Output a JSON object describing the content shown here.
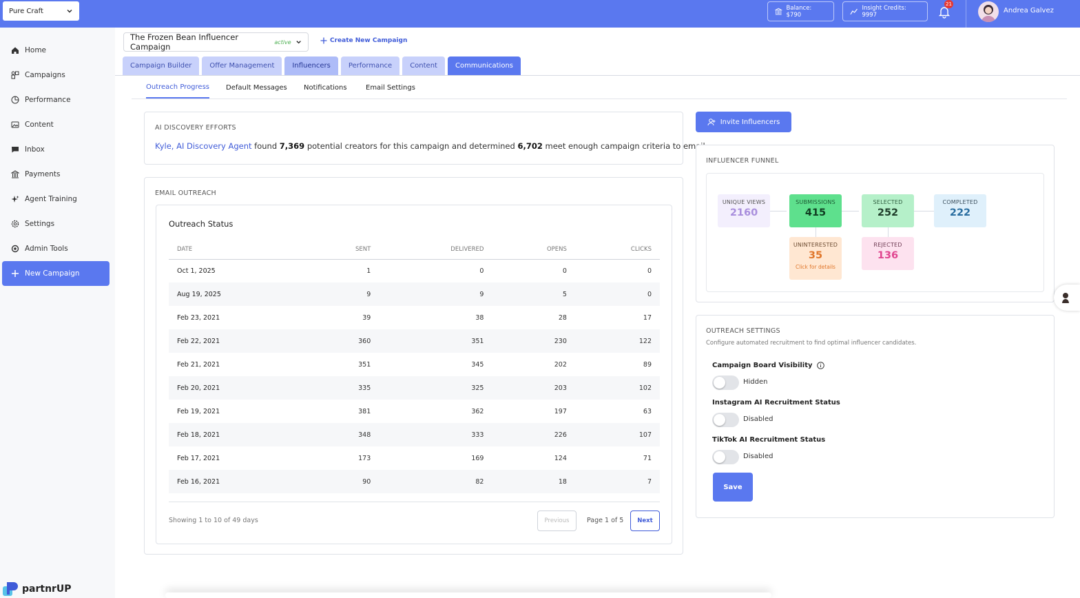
{
  "topbar": {
    "org": "Pure Craft",
    "balance": "Balance: $790",
    "credits": "Insight Credits: 9997",
    "notif_count": "21",
    "user_name": "Andrea Galvez"
  },
  "sidebar": {
    "items": [
      {
        "label": "Home"
      },
      {
        "label": "Campaigns"
      },
      {
        "label": "Performance"
      },
      {
        "label": "Content"
      },
      {
        "label": "Inbox"
      },
      {
        "label": "Payments"
      },
      {
        "label": "Agent Training"
      },
      {
        "label": "Settings"
      },
      {
        "label": "Admin Tools"
      },
      {
        "label": "New Campaign"
      }
    ],
    "brand": "partnrUP"
  },
  "campaign": {
    "name": "The Frozen Bean Influencer Campaign",
    "status": "active",
    "create_label": "Create New Campaign"
  },
  "tabs": [
    "Campaign Builder",
    "Offer Management",
    "Influencers",
    "Performance",
    "Content",
    "Communications"
  ],
  "subtabs": [
    "Outreach Progress",
    "Default Messages",
    "Notifications",
    "Email Settings"
  ],
  "discovery": {
    "title": "AI DISCOVERY EFFORTS",
    "agent": "Kyle, AI Discovery Agent",
    "found_word": "found",
    "found": "7,369",
    "mid_text": "potential creators for this campaign and determined",
    "met": "6,702",
    "end_text": "meet enough campaign criteria to email."
  },
  "outreach": {
    "title": "EMAIL OUTREACH",
    "subtitle": "Outreach Status",
    "columns": [
      "DATE",
      "SENT",
      "DELIVERED",
      "OPENS",
      "CLICKS"
    ],
    "rows": [
      [
        "Oct 1, 2025",
        "1",
        "0",
        "0",
        "0"
      ],
      [
        "Aug 19, 2025",
        "9",
        "9",
        "5",
        "0"
      ],
      [
        "Feb 23, 2021",
        "39",
        "38",
        "28",
        "17"
      ],
      [
        "Feb 22, 2021",
        "360",
        "351",
        "230",
        "122"
      ],
      [
        "Feb 21, 2021",
        "351",
        "345",
        "202",
        "89"
      ],
      [
        "Feb 20, 2021",
        "335",
        "325",
        "203",
        "102"
      ],
      [
        "Feb 19, 2021",
        "381",
        "362",
        "197",
        "63"
      ],
      [
        "Feb 18, 2021",
        "348",
        "333",
        "226",
        "107"
      ],
      [
        "Feb 17, 2021",
        "173",
        "169",
        "124",
        "71"
      ],
      [
        "Feb 16, 2021",
        "90",
        "82",
        "18",
        "7"
      ]
    ],
    "showing": "Showing 1 to 10 of 49 days",
    "prev": "Previous",
    "page": "Page 1 of 5",
    "next": "Next"
  },
  "invite_label": "Invite Influencers",
  "funnel": {
    "title": "INFLUENCER FUNNEL",
    "unique_views": {
      "label": "UNIQUE VIEWS",
      "value": "2160"
    },
    "submissions": {
      "label": "SUBMISSIONS",
      "value": "415"
    },
    "selected": {
      "label": "SELECTED",
      "value": "252"
    },
    "completed": {
      "label": "COMPLETED",
      "value": "222"
    },
    "uninterested": {
      "label": "UNINTERESTED",
      "value": "35",
      "detail": "Click for details"
    },
    "rejected": {
      "label": "REJECTED",
      "value": "136"
    }
  },
  "settings": {
    "title": "OUTREACH SETTINGS",
    "desc": "Configure automated recruitment to find optimal influencer candidates.",
    "board_label": "Campaign Board Visibility",
    "board_state": "Hidden",
    "ig_label": "Instagram AI Recruitment Status",
    "ig_state": "Disabled",
    "tt_label": "TikTok AI Recruitment Status",
    "tt_state": "Disabled",
    "save": "Save"
  },
  "colors": {
    "primary": "#5a78ef",
    "link": "#3f5bd8"
  }
}
